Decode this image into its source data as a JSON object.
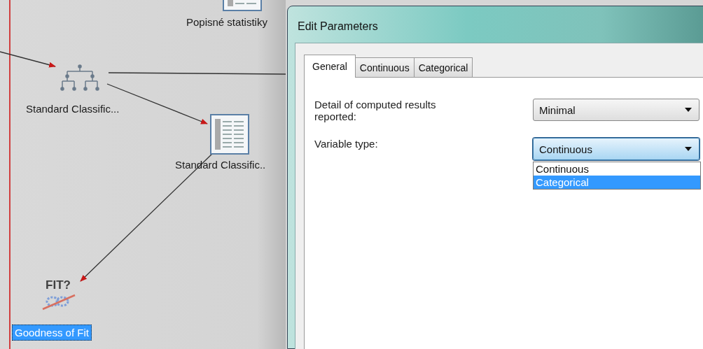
{
  "canvas": {
    "nodes": [
      {
        "kind": "table",
        "label": "Popisné statistiky",
        "selected": false
      },
      {
        "kind": "tree",
        "label": "Standard Classific...",
        "selected": false
      },
      {
        "kind": "table",
        "label": "Standard Classific..",
        "selected": false
      },
      {
        "kind": "fit",
        "icon_text": "FIT?",
        "label": "Goodness of Fit",
        "selected": true
      }
    ]
  },
  "dialog": {
    "title": "Edit Parameters",
    "tabs": [
      {
        "label": "General",
        "selected": true
      },
      {
        "label": "Continuous",
        "selected": false
      },
      {
        "label": "Categorical",
        "selected": false
      }
    ],
    "fields": [
      {
        "label": "Detail of computed results reported:",
        "value": "Minimal",
        "focused": false
      },
      {
        "label": "Variable type:",
        "value": "Continuous",
        "focused": true,
        "options": [
          {
            "label": "Continuous",
            "highlighted": false
          },
          {
            "label": "Categorical",
            "highlighted": true
          }
        ]
      }
    ]
  }
}
